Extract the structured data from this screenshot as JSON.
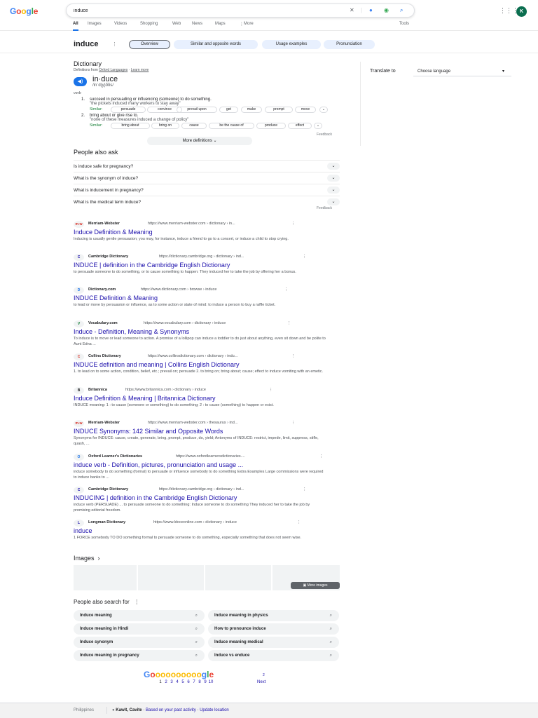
{
  "logo": [
    "G",
    "o",
    "o",
    "g",
    "l",
    "e"
  ],
  "logo_colors": [
    "#4285f4",
    "#ea4335",
    "#fbbc05",
    "#4285f4",
    "#34a853",
    "#ea4335"
  ],
  "search": {
    "query": "induce"
  },
  "header": {
    "avatar": "K"
  },
  "nav": {
    "tabs": [
      "All",
      "Images",
      "Videos",
      "Shopping",
      "Web",
      "News",
      "Maps",
      "More"
    ],
    "tools": "Tools"
  },
  "term": {
    "word": "induce",
    "chips": [
      "Overview",
      "Similar and opposite words",
      "Usage examples",
      "Pronunciation"
    ]
  },
  "dictionary": {
    "title": "Dictionary",
    "source_prefix": "Definitions from",
    "source_name": "Oxford Languages",
    "learn_more": "Learn more",
    "headword": "in·duce",
    "phonetic": "/inˈd(y)o͞os/",
    "pos": "verb",
    "senses": [
      {
        "num": "1.",
        "text": "succeed in persuading or influencing (someone) to do something.",
        "example": "\"the pickets induced many workers to stay away\"",
        "similar_label": "Similar:",
        "similar": [
          "persuade",
          "convince",
          "prevail upon",
          "get",
          "make",
          "prompt",
          "move"
        ]
      },
      {
        "num": "2.",
        "text": "bring about or give rise to.",
        "example": "\"none of these measures induced a change of policy\"",
        "similar_label": "Similar:",
        "similar": [
          "bring about",
          "bring on",
          "cause",
          "be the cause of",
          "produce",
          "effect"
        ]
      }
    ],
    "feedback": "Feedback",
    "more_definitions": "More definitions"
  },
  "translate": {
    "label": "Translate to",
    "placeholder": "Choose language"
  },
  "paa": {
    "title": "People also ask",
    "questions": [
      "Is induce safe for pregnancy?",
      "What is the synonym of induce?",
      "What is inducement in pregnancy?",
      "What is the medical term induce?"
    ],
    "feedback": "Feedback"
  },
  "results": [
    {
      "fav": "m-w",
      "site": "Merriam-Webster",
      "url": "https://www.merriam-webster.com › dictionary › in...",
      "title": "Induce Definition & Meaning",
      "snippet": "Inducing is usually gentle persuasion; you may, for instance, induce a friend to go to a concert, or induce a child to stop crying."
    },
    {
      "fav": "C",
      "site": "Cambridge Dictionary",
      "url": "https://dictionary.cambridge.org › dictionary › ind...",
      "title": "INDUCE | definition in the Cambridge English Dictionary",
      "snippet": "to persuade someone to do something, or to cause something to happen: They induced her to take the job by offering her a bonus."
    },
    {
      "fav": "D",
      "site": "Dictionary.com",
      "url": "https://www.dictionary.com › browse › induce",
      "title": "INDUCE Definition & Meaning",
      "snippet": "to lead or move by persuasion or influence, as to some action or state of mind: to induce a person to buy a raffle ticket."
    },
    {
      "fav": "V",
      "site": "Vocabulary.com",
      "url": "https://www.vocabulary.com › dictionary › induce",
      "title": "Induce - Definition, Meaning & Synonyms",
      "snippet": "To induce is to move or lead someone to action. A promise of a lollipop can induce a toddler to do just about anything, even sit down and be polite to Aunt Edna ..."
    },
    {
      "fav": "C",
      "site": "Collins Dictionary",
      "url": "https://www.collinsdictionary.com › dictionary › indu...",
      "title": "INDUCE definition and meaning | Collins English Dictionary",
      "snippet": "1. to lead on to some action, condition, belief, etc.; prevail on; persuade 2. to bring on; bring about; cause; effect to induce vomiting with an emetic."
    },
    {
      "fav": "B",
      "site": "Britannica",
      "url": "https://www.britannica.com › dictionary › induce",
      "title": "Induce Definition & Meaning | Britannica Dictionary",
      "snippet": "INDUCE meaning: 1 : to cause (someone or something) to do something; 2 : to cause (something) to happen or exist."
    },
    {
      "fav": "m-w",
      "site": "Merriam-Webster",
      "url": "https://www.merriam-webster.com › thesaurus › ind...",
      "title": "INDUCE Synonyms: 142 Similar and Opposite Words",
      "snippet": "Synonyms for INDUCE: cause, create, generate, bring, prompt, produce, do, yield; Antonyms of INDUCE: restrict, impede, limit, suppress, stifle, quash, ..."
    },
    {
      "fav": "O",
      "site": "Oxford Learner's Dictionaries",
      "url": "https://www.oxfordlearnersdictionaries....",
      "title": "induce verb - Definition, pictures, pronunciation and usage ...",
      "snippet": "induce somebody to do something (formal) to persuade or influence somebody to do something Extra Examples Large commissions were required to induce banks to ..."
    },
    {
      "fav": "C",
      "site": "Cambridge Dictionary",
      "url": "https://dictionary.cambridge.org › dictionary › ind...",
      "title": "INDUCING | definition in the Cambridge English Dictionary",
      "snippet": "induce verb (PERSUADE) ... to persuade someone to do something: Induce someone to do something They induced her to take the job by promising editorial freedom."
    },
    {
      "fav": "L",
      "site": "Longman Dictionary",
      "url": "https://www.ldoceonline.com › dictionary › induce",
      "title": "induce",
      "snippet": "1 FORCE somebody TO DO something formal to persuade someone to do something, especially something that does not seem wise."
    }
  ],
  "images": {
    "title": "Images",
    "more": "More images"
  },
  "pas": {
    "title": "People also search for",
    "items": [
      "Induce meaning",
      "Induce meaning in physics",
      "Induce meaning in Hindi",
      "How to pronounce induce",
      "Induce synonym",
      "Induce meaning medical",
      "Induce meaning in pregnancy",
      "Induce vs enduce"
    ]
  },
  "pager": {
    "logo": "Goooooooooogle",
    "pages": [
      "1",
      "2",
      "3",
      "4",
      "5",
      "6",
      "7",
      "8",
      "9",
      "10"
    ],
    "next_num": "2",
    "next": "Next"
  },
  "footer": {
    "country": "Philippines",
    "location": "Kawit, Cavite",
    "based_on": "Based on your past activity",
    "sep": "-",
    "update": "Update location"
  }
}
